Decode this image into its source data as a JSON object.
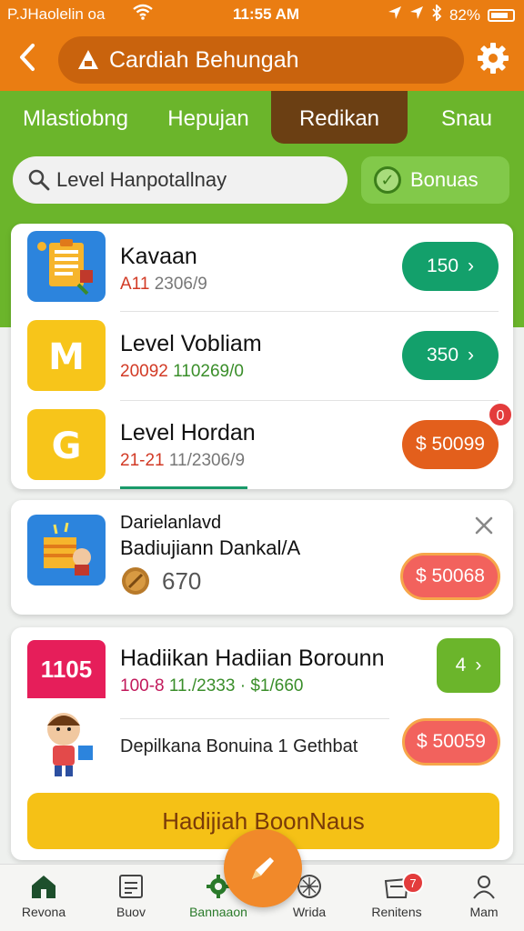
{
  "status": {
    "carrier": "P.JHaolelin oa",
    "time": "11:55 AM",
    "battery": "82%"
  },
  "appbar": {
    "title": "Cardiah Behungah"
  },
  "tabs": [
    {
      "label": "Mlastiobng"
    },
    {
      "label": "Hepujan"
    },
    {
      "label": "Redikan"
    },
    {
      "label": "Snau"
    }
  ],
  "search": {
    "value": "Level Hanpotallnay"
  },
  "bonus_button": {
    "label": "Bonuas"
  },
  "list1": [
    {
      "title": "Kavaan",
      "sub1": "A11",
      "sub2": "2306/9",
      "price": "150"
    },
    {
      "title": "Level Vobliam",
      "sub1": "20092",
      "sub2": "110269/0",
      "price": "350"
    },
    {
      "title": "Level Hordan",
      "sub1": "21-21",
      "sub2": "11/2306/9",
      "price": "$ 50099",
      "badge": "0"
    }
  ],
  "card2": {
    "line1": "Darielanlavd",
    "line2": "Badiujiann Dankal/A",
    "coins": "670",
    "price": "$ 50068"
  },
  "card3": {
    "tag": "1105",
    "title": "Hadiikan Hadiian Borounn",
    "sub1": "100-8",
    "sub2": "11./2333",
    "sub3": "$1/660",
    "price1": "4",
    "desc": "Depilkana Bonuina 1 Gethbat",
    "price2": "$ 50059"
  },
  "cta": {
    "label": "Hadijiah BoonNaus"
  },
  "nav": [
    {
      "label": "Revona"
    },
    {
      "label": "Buov"
    },
    {
      "label": "Bannaaon"
    },
    {
      "label": "Wrida"
    },
    {
      "label": "Renitens",
      "badge": "7"
    },
    {
      "label": "Mam"
    }
  ],
  "colors": {
    "header": "#ea7d12",
    "tabbar": "#6bb52b",
    "active_tab": "#6b3f13",
    "primary_green": "#13a06b",
    "orange": "#e35f1c",
    "cta": "#f5c116"
  }
}
